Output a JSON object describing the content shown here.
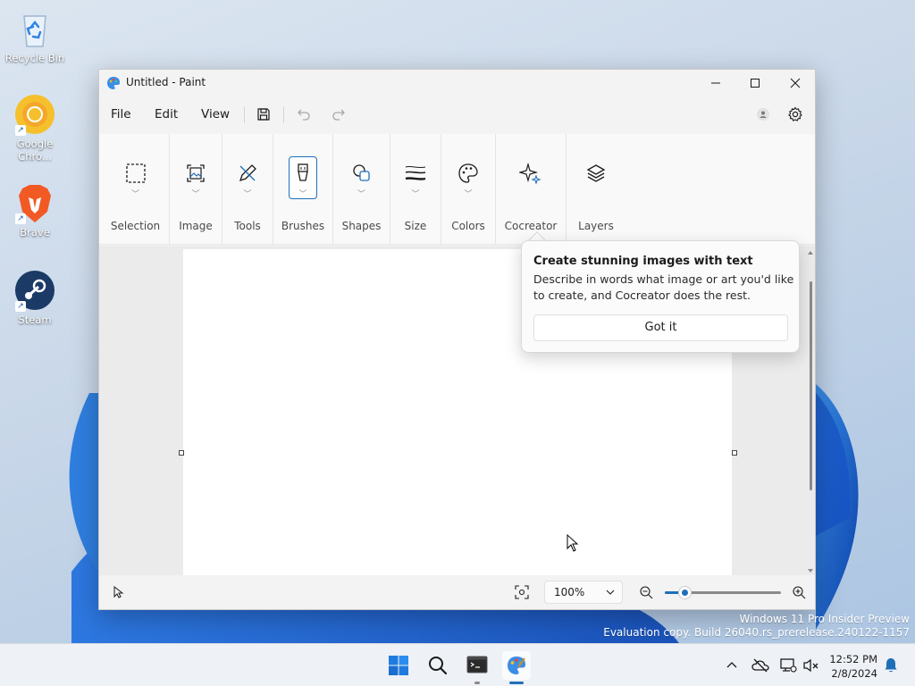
{
  "desktop": {
    "icons": [
      {
        "label": "Recycle Bin"
      },
      {
        "label": "Google Chro..."
      },
      {
        "label": "Brave"
      },
      {
        "label": "Steam"
      }
    ],
    "watermark": {
      "line1": "Windows 11 Pro Insider Preview",
      "line2": "Evaluation copy. Build 26040.rs_prerelease.240122-1157"
    }
  },
  "window": {
    "title": "Untitled - Paint",
    "menu": {
      "file": "File",
      "edit": "Edit",
      "view": "View"
    },
    "ribbon": {
      "groups": [
        {
          "label": "Selection"
        },
        {
          "label": "Image"
        },
        {
          "label": "Tools"
        },
        {
          "label": "Brushes"
        },
        {
          "label": "Shapes"
        },
        {
          "label": "Size"
        },
        {
          "label": "Colors"
        },
        {
          "label": "Cocreator"
        },
        {
          "label": "Layers"
        }
      ]
    },
    "teaching_tip": {
      "title": "Create stunning images with text",
      "body": "Describe in words what image or art you'd like to create, and Cocreator does the rest.",
      "button": "Got it"
    },
    "status": {
      "zoom_value": "100%",
      "zoom_slider_fraction": 0.17
    }
  },
  "taskbar": {
    "time": "12:52 PM",
    "date": "2/8/2024"
  },
  "colors": {
    "accent": "#1f6fb8",
    "taskbar": "#eef1f5",
    "window_bg": "#f3f3f3"
  }
}
